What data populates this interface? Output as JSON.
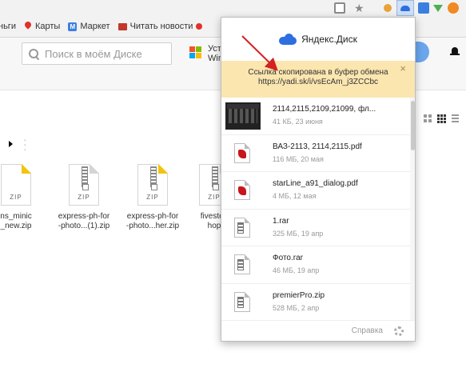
{
  "bookmarks": [
    {
      "label": "ньги",
      "icon": "none"
    },
    {
      "label": "Карты",
      "icon": "map-pin-icon"
    },
    {
      "label": "Маркет",
      "icon": "market-icon"
    },
    {
      "label": "Читать новости",
      "icon": "news-icon"
    }
  ],
  "disk": {
    "search_placeholder": "Поиск в моём Диске",
    "banner_text_line1": "Уст",
    "banner_text_line2": "Win",
    "files": [
      {
        "name_line1": "ns_minic",
        "name_line2": "_new.zip",
        "type_label": "ZIP"
      },
      {
        "name_line1": "express-ph-for",
        "name_line2": "-photo...(1).zip",
        "type_label": "ZIP"
      },
      {
        "name_line1": "express-ph-for",
        "name_line2": "-photo...her.zip",
        "type_label": "ZIP"
      },
      {
        "name_line1": "fivestep",
        "name_line2": "hop",
        "type_label": "ZIP"
      }
    ]
  },
  "popup": {
    "brand": "Яндекс.Диск",
    "notice": {
      "message": "Ссылка скопирована в буфер обмена",
      "link": "https://yadi.sk/i/vsEcAm_j3ZCCbc",
      "close": "×"
    },
    "files": [
      {
        "name": "2114,2115,2109,21099, фл...",
        "meta": "41 КБ, 23 июня",
        "icon": "photo-thumbnail"
      },
      {
        "name": "ВАЗ-2113, 2114,2115.pdf",
        "meta": "116 МБ, 20 мая",
        "icon": "pdf-icon"
      },
      {
        "name": "starLine_a91_dialog.pdf",
        "meta": "4 МБ, 12 мая",
        "icon": "pdf-icon"
      },
      {
        "name": "1.rar",
        "meta": "325 МБ, 19 апр",
        "icon": "archive-icon"
      },
      {
        "name": "Фото.rar",
        "meta": "46 МБ, 19 апр",
        "icon": "archive-icon"
      },
      {
        "name": "premierPro.zip",
        "meta": "528 МБ, 2 апр",
        "icon": "archive-icon"
      }
    ],
    "footer": {
      "help": "Справка"
    }
  },
  "colors": {
    "notice_bg": "#fbe6b0",
    "brand_blue": "#2d6ee0",
    "arrow": "#d42121",
    "pdf_red": "#c8151b"
  }
}
